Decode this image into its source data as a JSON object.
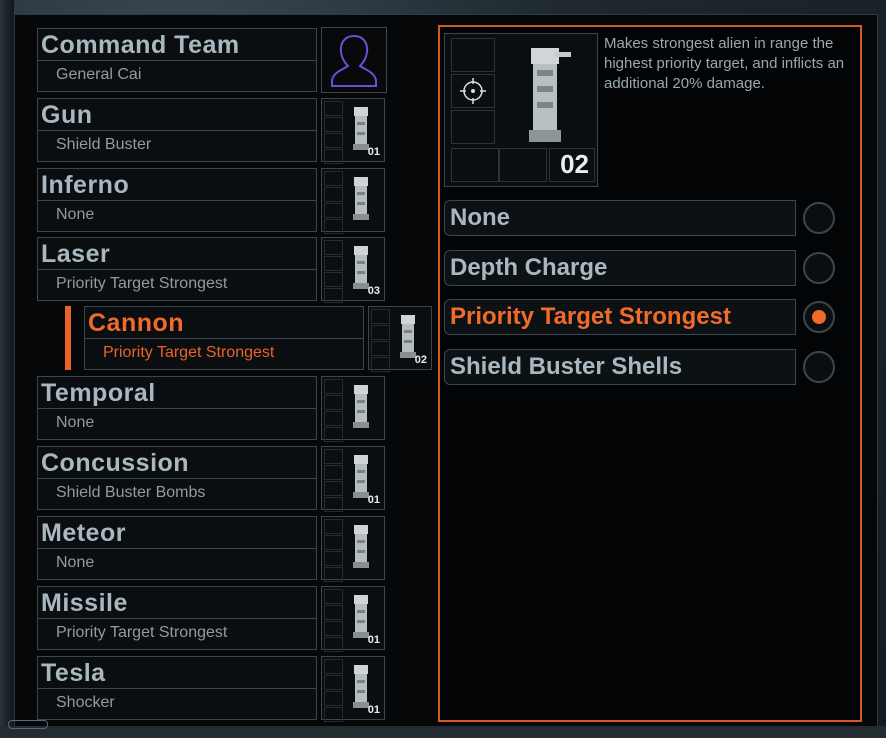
{
  "tower_list": [
    {
      "title": "Command Team",
      "subtitle": "General Cai",
      "level": "",
      "icon": "commander-silhouette-icon"
    },
    {
      "title": "Gun",
      "subtitle": "Shield Buster",
      "level": "01",
      "icon": "gun-tower-icon"
    },
    {
      "title": "Inferno",
      "subtitle": "None",
      "level": "",
      "icon": "inferno-tower-icon"
    },
    {
      "title": "Laser",
      "subtitle": "Priority Target Strongest",
      "level": "03",
      "icon": "laser-tower-icon"
    },
    {
      "title": "Cannon",
      "subtitle": "Priority Target Strongest",
      "level": "02",
      "icon": "cannon-tower-icon"
    },
    {
      "title": "Temporal",
      "subtitle": "None",
      "level": "",
      "icon": "temporal-tower-icon"
    },
    {
      "title": "Concussion",
      "subtitle": "Shield Buster Bombs",
      "level": "01",
      "icon": "concussion-tower-icon"
    },
    {
      "title": "Meteor",
      "subtitle": "None",
      "level": "",
      "icon": "meteor-tower-icon"
    },
    {
      "title": "Missile",
      "subtitle": "Priority Target Strongest",
      "level": "01",
      "icon": "missile-tower-icon"
    },
    {
      "title": "Tesla",
      "subtitle": "Shocker",
      "level": "01",
      "icon": "tesla-tower-icon"
    }
  ],
  "detail": {
    "description": "Makes strongest alien in range the highest priority target, and inflicts an additional 20% damage.",
    "level": "02",
    "icon": "cannon-tower-icon"
  },
  "options": [
    {
      "label": "None",
      "selected": false
    },
    {
      "label": "Depth Charge",
      "selected": false
    },
    {
      "label": "Priority Target Strongest",
      "selected": true
    },
    {
      "label": "Shield Buster Shells",
      "selected": false
    }
  ],
  "colors": {
    "accent": "#e8622a",
    "text": "#a9b8c0",
    "border": "#3a474e"
  }
}
